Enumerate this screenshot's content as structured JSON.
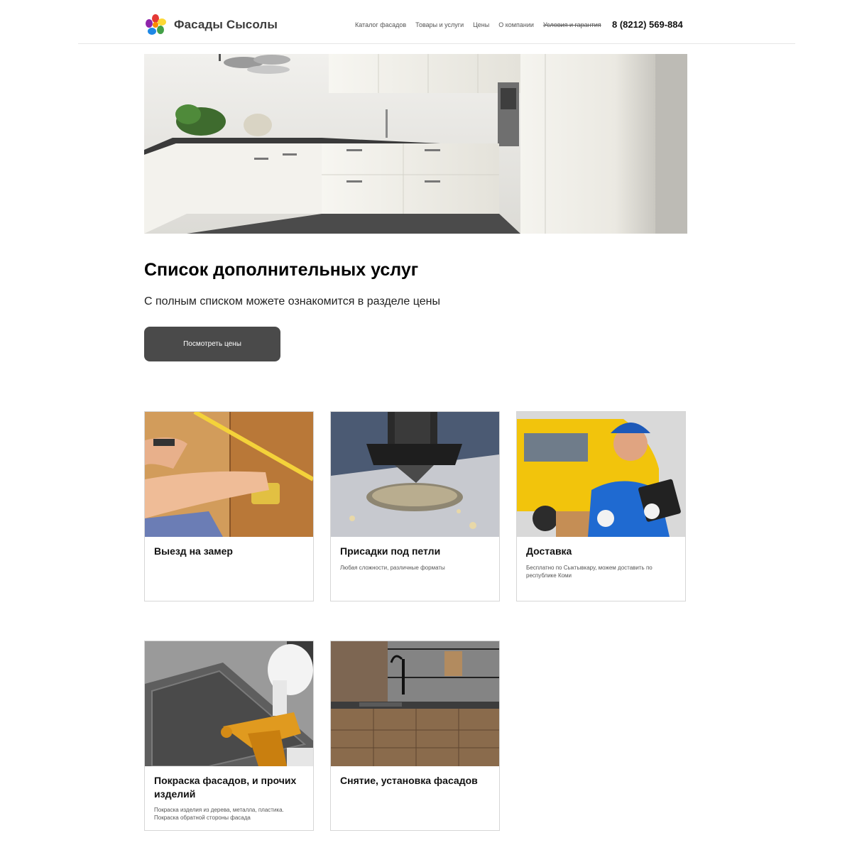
{
  "header": {
    "brand": "Фасады Сысолы",
    "nav": [
      {
        "label": "Каталог фасадов"
      },
      {
        "label": "Товары и услуги"
      },
      {
        "label": "Цены"
      },
      {
        "label": "О компании"
      },
      {
        "label": "Условия и гарантия"
      }
    ],
    "phone": "8 (8212) 569-884"
  },
  "main": {
    "title": "Список дополнительных услуг",
    "subtitle": "С полным списком можете ознакомится в разделе цены",
    "button_label": "Посмотреть цены"
  },
  "cards": [
    {
      "title": "Выезд на замер",
      "desc": ""
    },
    {
      "title": "Присадки под петли",
      "desc": "Любая сложности, различные форматы"
    },
    {
      "title": "Доставка",
      "desc": "Бесплатно по Сыктывкару, можем доставить по республике Коми"
    },
    {
      "title": "Покраска фасадов, и прочих изделий",
      "desc": "Покраска изделия из дерева, металла, пластика. Покраска обратной стороны фасада"
    },
    {
      "title": "Снятие, установка фасадов",
      "desc": ""
    }
  ],
  "colors": {
    "button_bg": "#4a4a4a",
    "text": "#111111",
    "divider": "#e6e6e6"
  }
}
